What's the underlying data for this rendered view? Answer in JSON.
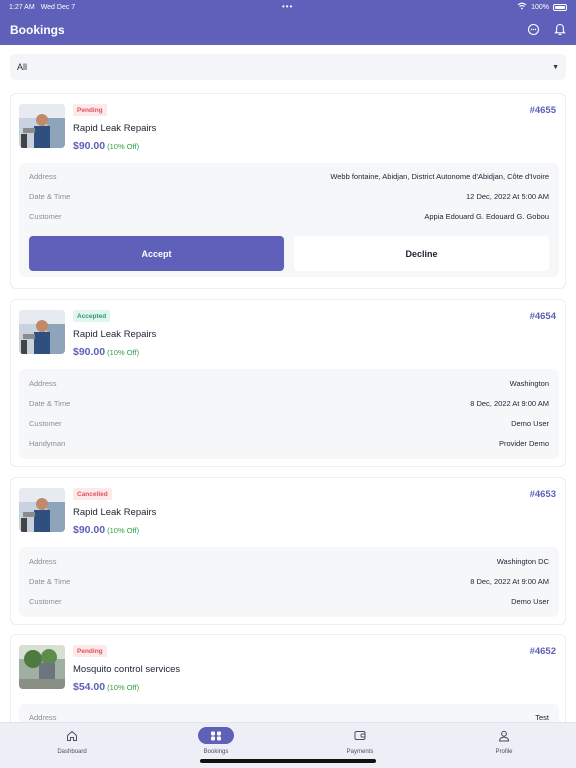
{
  "status_bar": {
    "time": "1:27 AM",
    "date": "Wed Dec 7",
    "dots": "•••",
    "battery": "100%"
  },
  "header": {
    "title": "Bookings"
  },
  "filter": {
    "value": "All"
  },
  "bookings": [
    {
      "status": "Pending",
      "id": "#4655",
      "service": "Rapid Leak Repairs",
      "price": "$90.00",
      "discount": "(10% Off)",
      "details": [
        {
          "label": "Address",
          "value": "Webb fontaine, Abidjan, District Autonome d'Abidjan, Côte d'Ivoire"
        },
        {
          "label": "Date & Time",
          "value": "12 Dec, 2022 At 5:00 AM"
        },
        {
          "label": "Customer",
          "value": "Appia Edouard G. Edouard G. Gobou"
        }
      ],
      "accept_label": "Accept",
      "decline_label": "Decline"
    },
    {
      "status": "Accepted",
      "id": "#4654",
      "service": "Rapid Leak Repairs",
      "price": "$90.00",
      "discount": "(10% Off)",
      "details": [
        {
          "label": "Address",
          "value": "Washington"
        },
        {
          "label": "Date & Time",
          "value": "8 Dec, 2022 At 9:00 AM"
        },
        {
          "label": "Customer",
          "value": "Demo User"
        },
        {
          "label": "Handyman",
          "value": "Provider Demo"
        }
      ]
    },
    {
      "status": "Cancelled",
      "id": "#4653",
      "service": "Rapid Leak Repairs",
      "price": "$90.00",
      "discount": "(10% Off)",
      "details": [
        {
          "label": "Address",
          "value": "Washington DC"
        },
        {
          "label": "Date & Time",
          "value": "8 Dec, 2022 At 9:00 AM"
        },
        {
          "label": "Customer",
          "value": "Demo User"
        }
      ]
    },
    {
      "status": "Pending",
      "id": "#4652",
      "service": "Mosquito control services",
      "price": "$54.00",
      "discount": "(10% Off)",
      "details": [
        {
          "label": "Address",
          "value": "Test"
        }
      ]
    }
  ],
  "nav": {
    "items": [
      {
        "label": "Dashboard",
        "icon": "home-icon"
      },
      {
        "label": "Bookings",
        "icon": "bookings-icon",
        "active": true
      },
      {
        "label": "Payments",
        "icon": "wallet-icon"
      },
      {
        "label": "Profile",
        "icon": "profile-icon"
      }
    ]
  },
  "colors": {
    "primary": "#5f60b9",
    "pending": "#e0525d",
    "accepted": "#2c9b74",
    "discount": "#2f9e44"
  }
}
